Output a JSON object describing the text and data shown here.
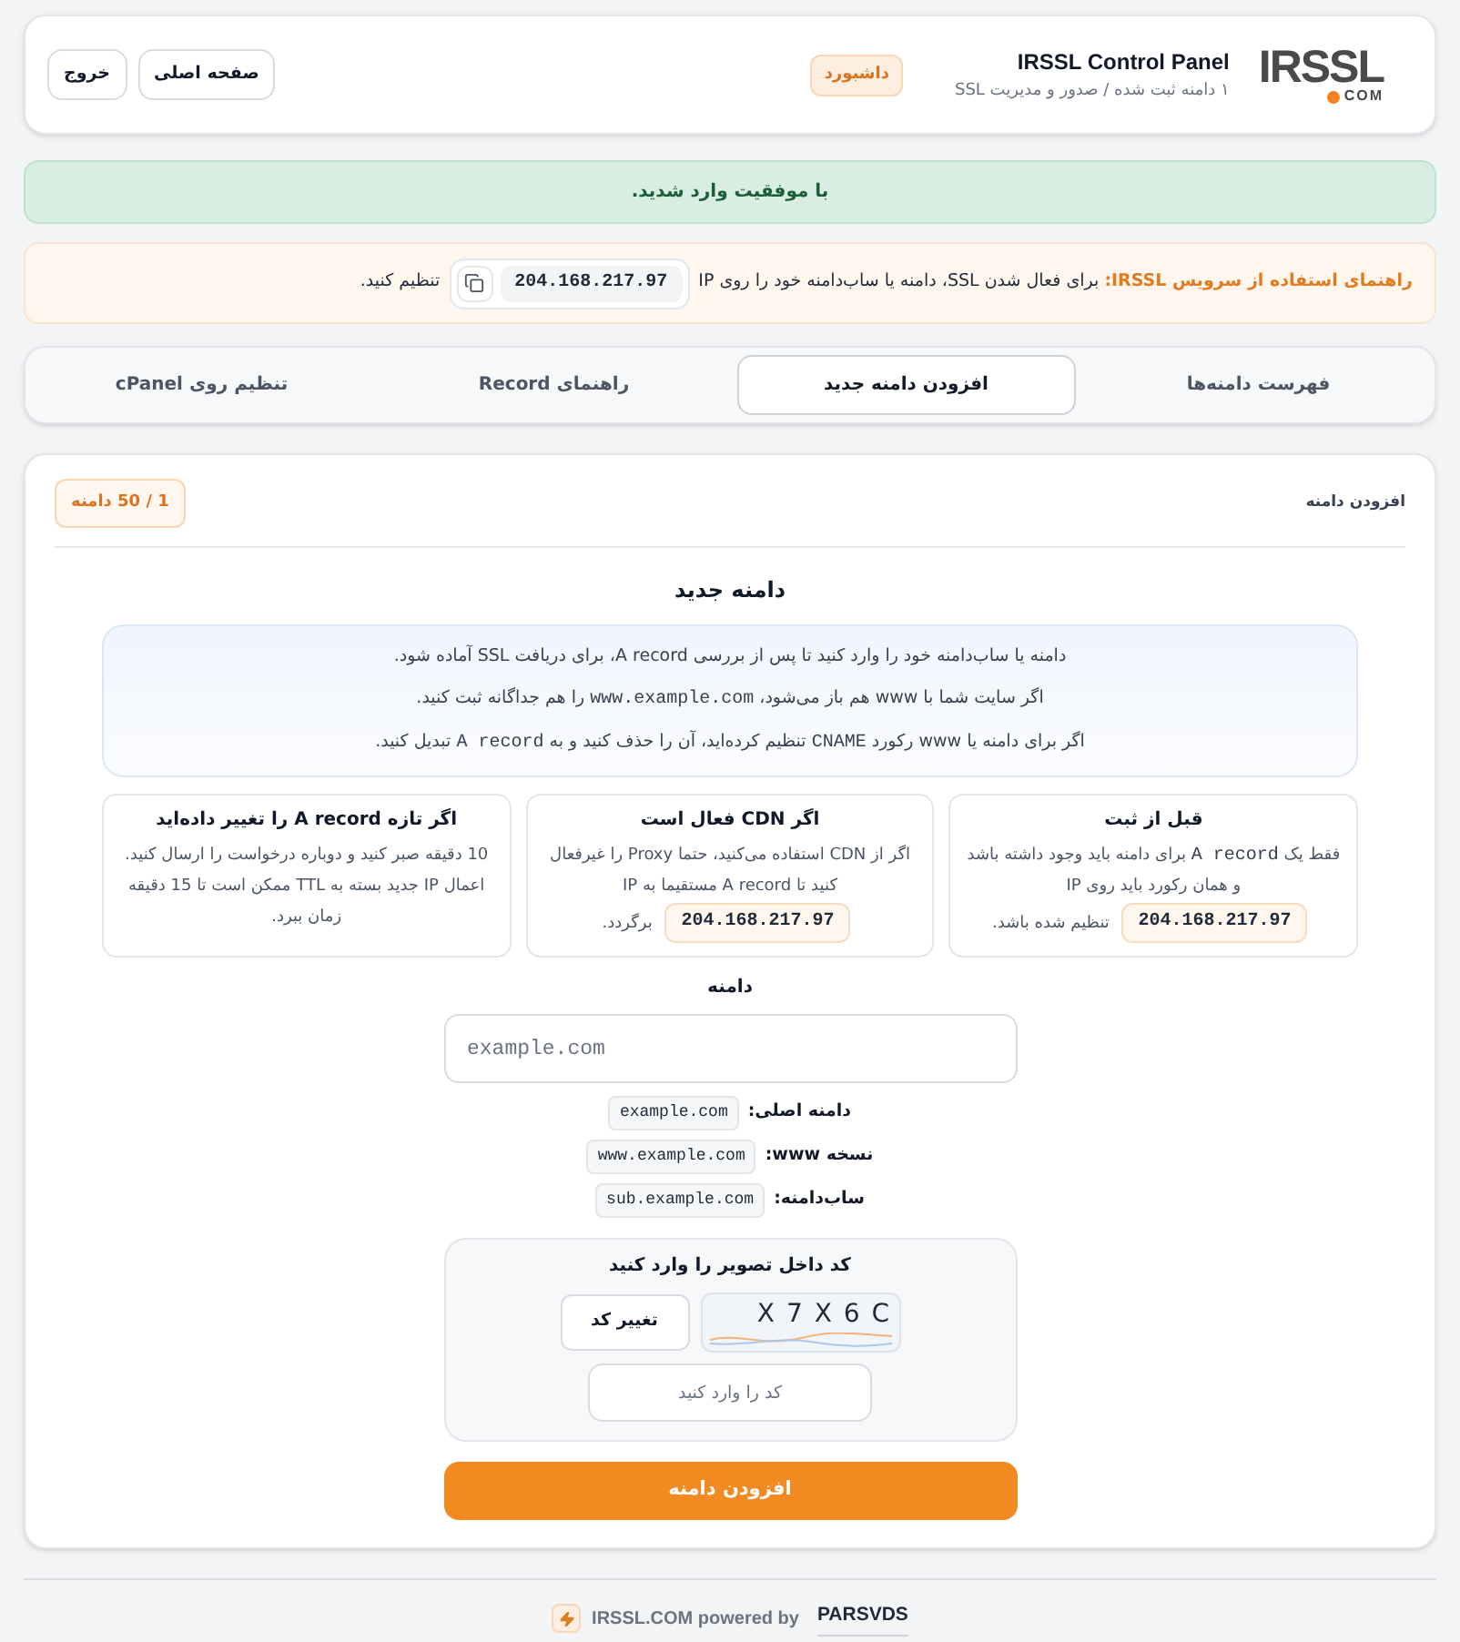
{
  "header": {
    "logo": {
      "name": "IRSSL",
      "suffix": "COM"
    },
    "title": "IRSSL Control Panel",
    "subtitle": "۱ دامنه ثبت شده / صدور و مدیریت SSL",
    "badge": "داشبورد",
    "buttons": [
      {
        "label": "صفحه اصلی"
      },
      {
        "label": "خروج"
      }
    ]
  },
  "success_alert": "با موفقیت وارد شدید.",
  "guide": {
    "title": "راهنمای استفاده از سرویس IRSSL:",
    "text_before": "برای فعال شدن SSL، دامنه یا ساب‌دامنه خود را روی IP",
    "ip": "204.168.217.97",
    "text_after": "تنظیم کنید."
  },
  "tabs": [
    {
      "label": "فهرست دامنه‌ها",
      "selected": false
    },
    {
      "label": "افزودن دامنه جدید",
      "selected": true
    },
    {
      "label": "راهنمای Record",
      "selected": false
    },
    {
      "label": "تنظیم روی cPanel",
      "selected": false
    }
  ],
  "panel": {
    "title": "افزودن دامنه",
    "quota": "1 / 50 دامنه",
    "form_title": "دامنه جدید",
    "info_lines": [
      [
        {
          "kind": "text",
          "text": "دامنه یا ساب‌دامنه خود را وارد کنید تا پس از بررسی A record، برای دریافت SSL آماده شود."
        }
      ],
      [
        {
          "kind": "text",
          "text": "اگر سایت شما با www هم باز می‌شود، "
        },
        {
          "kind": "code",
          "text": "www.example.com"
        },
        {
          "kind": "text",
          "text": " را هم جداگانه ثبت کنید."
        }
      ],
      [
        {
          "kind": "text",
          "text": "اگر برای دامنه یا www رکورد "
        },
        {
          "kind": "code",
          "text": "CNAME"
        },
        {
          "kind": "text",
          "text": " تنظیم کرده‌اید، آن را حذف کنید و به "
        },
        {
          "kind": "code",
          "text": "A record"
        },
        {
          "kind": "text",
          "text": " تبدیل کنید."
        }
      ]
    ],
    "tips": [
      {
        "title": "قبل از ثبت",
        "parts": [
          {
            "kind": "text",
            "text": "فقط یک "
          },
          {
            "kind": "code",
            "text": "A record"
          },
          {
            "kind": "text",
            "text": " برای دامنه باید وجود داشته باشد و همان رکورد باید روی IP "
          },
          {
            "kind": "ip",
            "text": "204.168.217.97"
          },
          {
            "kind": "text",
            "text": " تنظیم شده باشد."
          }
        ]
      },
      {
        "title": "اگر CDN فعال است",
        "parts": [
          {
            "kind": "text",
            "text": "اگر از CDN استفاده می‌کنید، حتما Proxy را غیرفعال کنید تا A record مستقیما به IP "
          },
          {
            "kind": "ip",
            "text": "204.168.217.97"
          },
          {
            "kind": "text",
            "text": " برگردد."
          }
        ]
      },
      {
        "title": "اگر تازه A record را تغییر داده‌اید",
        "parts": [
          {
            "kind": "text",
            "text": "10 دقیقه صبر کنید و دوباره درخواست را ارسال کنید. اعمال IP جدید بسته به TTL ممکن است تا 15 دقیقه زمان ببرد."
          }
        ]
      }
    ],
    "domain_field": {
      "label": "دامنه",
      "placeholder": "example.com"
    },
    "examples": [
      {
        "label": "دامنه اصلی:",
        "value": "example.com"
      },
      {
        "label": "نسخه www:",
        "value": "www.example.com"
      },
      {
        "label": "ساب‌دامنه:",
        "value": "sub.example.com"
      }
    ],
    "captcha": {
      "title": "کد داخل تصویر را وارد کنید",
      "code": "X 7 X 6 C",
      "refresh_button": "تغییر کد",
      "placeholder": "کد را وارد کنید"
    },
    "submit": "افزودن دامنه"
  },
  "footer": {
    "text": "IRSSL.COM powered by",
    "link": "PARSVDS"
  }
}
